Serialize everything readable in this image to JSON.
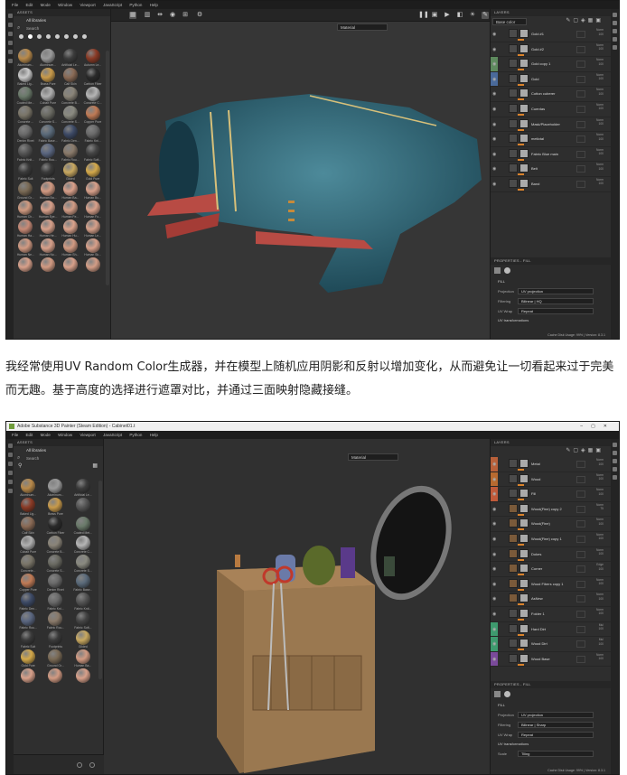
{
  "shot1": {
    "menu": [
      "File",
      "Edit",
      "Mode",
      "Window",
      "Viewport",
      "JavaScript",
      "Python",
      "Help"
    ],
    "assets": {
      "title": "ASSETS",
      "library": "All libraries",
      "search_placeholder": "Search",
      "materials": [
        {
          "label": "Aluminum...",
          "color": "#b98a4a"
        },
        {
          "label": "Aluminum...",
          "color": "#9a9a9a"
        },
        {
          "label": "Artificial Le...",
          "color": "#3c3c3c"
        },
        {
          "label": "Autumn Le...",
          "color": "#8a3a25"
        },
        {
          "label": "Baked Lig...",
          "color": "#c9c9c9"
        },
        {
          "label": "Brass Pure",
          "color": "#c89a4a"
        },
        {
          "label": "Calf Skin",
          "color": "#8a6a55"
        },
        {
          "label": "Carbon Fiber",
          "color": "#2a2a2a"
        },
        {
          "label": "Coated Me...",
          "color": "#6a7a6a"
        },
        {
          "label": "Cobalt Pure",
          "color": "#b0b0b0"
        },
        {
          "label": "Concrete B...",
          "color": "#8a8478"
        },
        {
          "label": "Concrete C...",
          "color": "#b5b5b5"
        },
        {
          "label": "Concrete ...",
          "color": "#7a7568"
        },
        {
          "label": "Concrete S...",
          "color": "#6a6a62"
        },
        {
          "label": "Concrete S...",
          "color": "#8a8a80"
        },
        {
          "label": "Copper Pure",
          "color": "#c07a55"
        },
        {
          "label": "Denim Rivet",
          "color": "#6a6a6a"
        },
        {
          "label": "Fabric Base...",
          "color": "#5a6a7a"
        },
        {
          "label": "Fabric Den...",
          "color": "#3d4a66"
        },
        {
          "label": "Fabric Kni...",
          "color": "#6a6a6a"
        },
        {
          "label": "Fabric Knit...",
          "color": "#555"
        },
        {
          "label": "Fabric Rou...",
          "color": "#5a6680"
        },
        {
          "label": "Fabric Rou...",
          "color": "#8a7a6a"
        },
        {
          "label": "Fabric Soft...",
          "color": "#444"
        },
        {
          "label": "Fabric Suit",
          "color": "#3a3a3a"
        },
        {
          "label": "Footprints",
          "color": "#3a3a3a"
        },
        {
          "label": "Gilded",
          "color": "#c8a860"
        },
        {
          "label": "Gold Pure",
          "color": "#d4a94a"
        },
        {
          "label": "Ground Gr...",
          "color": "#7a6a55"
        },
        {
          "label": "Human Ba...",
          "color": "#d29a82"
        },
        {
          "label": "Human Ba...",
          "color": "#d9a08a"
        },
        {
          "label": "Human Bu...",
          "color": "#d8a08a"
        },
        {
          "label": "Human Ch...",
          "color": "#d09a80"
        },
        {
          "label": "Human Eye...",
          "color": "#d8a08a"
        },
        {
          "label": "Human Fe...",
          "color": "#d39d86"
        },
        {
          "label": "Human Fo...",
          "color": "#d8a08a"
        },
        {
          "label": "Human Ha...",
          "color": "#c88a76"
        },
        {
          "label": "Human He...",
          "color": "#d8a08a"
        },
        {
          "label": "Human Hu...",
          "color": "#dba38c"
        },
        {
          "label": "Human Le...",
          "color": "#d6a08a"
        },
        {
          "label": "Human Ne...",
          "color": "#d29a82"
        },
        {
          "label": "Human No...",
          "color": "#d8a08a"
        },
        {
          "label": "Human Sh...",
          "color": "#d29a82"
        },
        {
          "label": "Human Sk...",
          "color": "#d8a08a"
        },
        {
          "label": "",
          "color": "#d8a08a"
        },
        {
          "label": "",
          "color": "#d29a82"
        },
        {
          "label": "",
          "color": "#d8a08a"
        },
        {
          "label": "",
          "color": "#d39d86"
        }
      ]
    },
    "viewport": {
      "material_dropdown": "Material"
    },
    "layers": {
      "title": "LAYERS",
      "base_color_dropdown": "Base color",
      "items": [
        {
          "name": "Gold #1",
          "color": "",
          "type": "fill",
          "blend": "Norm",
          "opacity": "100"
        },
        {
          "name": "Gold #2",
          "color": "",
          "type": "fill",
          "blend": "Norm",
          "opacity": "100"
        },
        {
          "name": "Gold copy 1",
          "color": "#5e8a5e",
          "type": "fill",
          "blend": "Norm",
          "opacity": "100"
        },
        {
          "name": "Gold",
          "color": "#4a6a9a",
          "type": "fill",
          "blend": "Norm",
          "opacity": "100"
        },
        {
          "name": "Cotton cuberer",
          "color": "",
          "type": "fill",
          "blend": "Norm",
          "opacity": "100"
        },
        {
          "name": "Cuerdas",
          "color": "",
          "type": "fill",
          "blend": "Norm",
          "opacity": "100"
        },
        {
          "name": "Mask/Placeholder",
          "color": "",
          "type": "fill",
          "blend": "Norm",
          "opacity": "100"
        },
        {
          "name": "metlotal",
          "color": "",
          "type": "fill",
          "blend": "Norm",
          "opacity": "100"
        },
        {
          "name": "Fabric Blue main",
          "color": "",
          "type": "fill",
          "blend": "Norm",
          "opacity": "100"
        },
        {
          "name": "Belt",
          "color": "",
          "type": "fill",
          "blend": "Norm",
          "opacity": "100"
        },
        {
          "name": "Band",
          "color": "",
          "type": "fill",
          "blend": "Norm",
          "opacity": "100"
        }
      ]
    },
    "properties": {
      "title": "PROPERTIES - FILL",
      "section_fill": "FILL",
      "rows": [
        {
          "label": "Projection",
          "value": "UV projection"
        },
        {
          "label": "Filtering",
          "value": "Bilinear | HQ"
        },
        {
          "label": "UV Wrap",
          "value": "Repeat"
        }
      ],
      "section_uv": "UV transformations",
      "status": "Cache Disk Usage:  99% | Version: 8.3.1"
    }
  },
  "caption": "我经常使用UV Random Color生成器，并在模型上随机应用阴影和反射以增加变化，从而避免让一切看起来过于完美而无趣。基于高度的选择进行遮罩对比，并通过三面映射隐藏接缝。",
  "shot2": {
    "window_title": "Adobe Substance 3D Painter (Steam Edition) - Cabinet01.t",
    "menu": [
      "File",
      "Edit",
      "Mode",
      "Window",
      "Viewport",
      "JavaScript",
      "Python",
      "Help"
    ],
    "assets": {
      "title": "ASSETS",
      "library": "All libraries",
      "search_placeholder": "Search",
      "materials": [
        {
          "label": "Aluminum...",
          "color": "#b98a4a"
        },
        {
          "label": "Aluminum...",
          "color": "#9a9a9a"
        },
        {
          "label": "Artificial Le...",
          "color": "#3c3c3c"
        },
        {
          "label": "Baked Lig...",
          "color": "#8a3a25"
        },
        {
          "label": "Brass Pure",
          "color": "#c89a4a"
        },
        {
          "label": "",
          "color": "#555"
        },
        {
          "label": "Calf Skin",
          "color": "#8a6a55"
        },
        {
          "label": "Carbon Fiber",
          "color": "#2a2a2a"
        },
        {
          "label": "Coated Met...",
          "color": "#6a7a6a"
        },
        {
          "label": "Cobalt Pure",
          "color": "#b0b0b0"
        },
        {
          "label": "Concrete B...",
          "color": "#8a8478"
        },
        {
          "label": "Concrete C...",
          "color": "#b5b5b5"
        },
        {
          "label": "Concrete...",
          "color": "#7a7568"
        },
        {
          "label": "Concrete S...",
          "color": "#6a6a62"
        },
        {
          "label": "Concrete S...",
          "color": "#8a8a80"
        },
        {
          "label": "Copper Pure",
          "color": "#c07a55"
        },
        {
          "label": "Denim Rivet",
          "color": "#6a6a6a"
        },
        {
          "label": "Fabric Base...",
          "color": "#5a6a7a"
        },
        {
          "label": "Fabric Den...",
          "color": "#3d4a66"
        },
        {
          "label": "Fabric Kni...",
          "color": "#6a6a6a"
        },
        {
          "label": "Fabric Knit...",
          "color": "#555"
        },
        {
          "label": "Fabric Rou...",
          "color": "#5a6680"
        },
        {
          "label": "Fabric Rou...",
          "color": "#8a7a6a"
        },
        {
          "label": "Fabric Soft...",
          "color": "#444"
        },
        {
          "label": "Fabric Suit",
          "color": "#3a3a3a"
        },
        {
          "label": "Footprints",
          "color": "#3a3a3a"
        },
        {
          "label": "Gilded",
          "color": "#c8a860"
        },
        {
          "label": "Gold Pure",
          "color": "#d4a94a"
        },
        {
          "label": "Ground Gr...",
          "color": "#7a6a55"
        },
        {
          "label": "Human Ba...",
          "color": "#d29a82"
        },
        {
          "label": "",
          "color": "#d8a08a"
        },
        {
          "label": "",
          "color": "#d29a82"
        },
        {
          "label": "",
          "color": "#d8a08a"
        }
      ]
    },
    "viewport": {
      "material_dropdown": "Material"
    },
    "layers": {
      "title": "LAYERS",
      "items": [
        {
          "name": "Metal",
          "color": "#b8603a",
          "type": "fill",
          "blend": "Norm",
          "opacity": "100"
        },
        {
          "name": "Wood",
          "color": "#b86a30",
          "type": "fill",
          "blend": "Norm",
          "opacity": "100"
        },
        {
          "name": "Fill",
          "color": "#c05a3a",
          "type": "fill",
          "blend": "Norm",
          "opacity": "100"
        },
        {
          "name": "Wood(Fine) copy 2",
          "color": "",
          "type": "paint",
          "blend": "Norm",
          "opacity": "75"
        },
        {
          "name": "Wood(Fine)",
          "color": "",
          "type": "paint",
          "blend": "Norm",
          "opacity": "100"
        },
        {
          "name": "Wood(Fine) copy 1",
          "color": "",
          "type": "paint",
          "blend": "Norm",
          "opacity": "100"
        },
        {
          "name": "Dokes",
          "color": "",
          "type": "paint",
          "blend": "Norm",
          "opacity": "100"
        },
        {
          "name": "Corner",
          "color": "",
          "type": "paint",
          "blend": "Edge",
          "opacity": "100"
        },
        {
          "name": "Wood Fibers copy 1",
          "color": "",
          "type": "paint",
          "blend": "Norm",
          "opacity": "100"
        },
        {
          "name": "AsNew",
          "color": "",
          "type": "paint",
          "blend": "Norm",
          "opacity": "100"
        },
        {
          "name": "Folder 1",
          "color": "",
          "type": "folder",
          "blend": "Norm",
          "opacity": "100"
        },
        {
          "name": "Hard Dirt",
          "color": "#3e9a6e",
          "type": "fill",
          "blend": "Mul",
          "opacity": "100"
        },
        {
          "name": "Wood Dirt",
          "color": "#3e9a6e",
          "type": "fill",
          "blend": "Mul",
          "opacity": "100"
        },
        {
          "name": "Wood Base",
          "color": "#7a4a9a",
          "type": "fill",
          "blend": "Norm",
          "opacity": "100"
        }
      ]
    },
    "properties": {
      "title": "PROPERTIES - FILL",
      "section_fill": "FILL",
      "rows": [
        {
          "label": "Projection",
          "value": "UV projection"
        },
        {
          "label": "Filtering",
          "value": "Bilinear | Sharp"
        },
        {
          "label": "UV Wrap",
          "value": "Repeat"
        }
      ],
      "section_uv": "UV transformations",
      "scale_label": "Scale",
      "scale_value": "Tiling",
      "status": "Cache Disk Usage:  99% | Version: 8.3.1"
    }
  }
}
